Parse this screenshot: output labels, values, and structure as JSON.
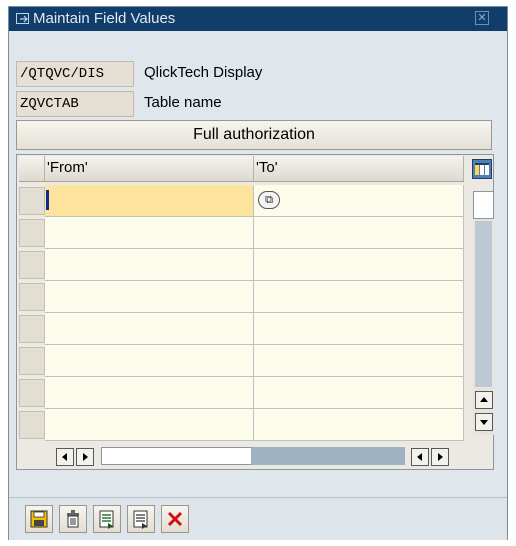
{
  "window": {
    "title": "Maintain Field Values"
  },
  "fields": {
    "object_key": "/QTQVC/DIS",
    "object_desc": "QlickTech Display",
    "table_key": "ZQVCTAB",
    "table_desc": "Table name"
  },
  "auth_button": {
    "label": "Full authorization"
  },
  "table": {
    "columns": [
      "'From'",
      "'To'"
    ],
    "row_count": 8,
    "rows": [
      {
        "from": "",
        "to": ""
      },
      {
        "from": "",
        "to": ""
      },
      {
        "from": "",
        "to": ""
      },
      {
        "from": "",
        "to": ""
      },
      {
        "from": "",
        "to": ""
      },
      {
        "from": "",
        "to": ""
      },
      {
        "from": "",
        "to": ""
      },
      {
        "from": "",
        "to": ""
      }
    ]
  },
  "toolbar": {
    "icons": [
      "save-icon",
      "delete-icon",
      "copy-line-icon",
      "paste-line-icon",
      "cancel-icon"
    ]
  },
  "colors": {
    "titlebar": "#113d6b",
    "active_cell": "#fde39b",
    "cell_bg": "#fdfcea",
    "cancel_red": "#d01010"
  }
}
